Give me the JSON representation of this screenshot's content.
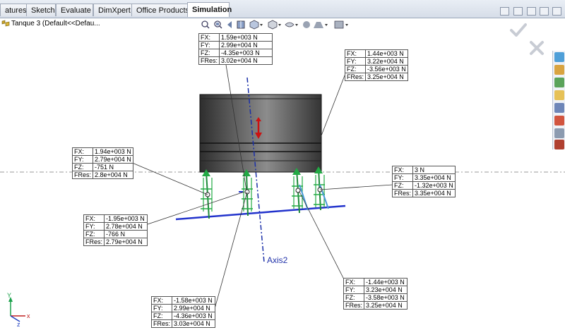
{
  "tabs": [
    {
      "label": "atures"
    },
    {
      "label": "Sketch"
    },
    {
      "label": "Evaluate"
    },
    {
      "label": "DimXpert"
    },
    {
      "label": "Office Products"
    },
    {
      "label": "Simulation",
      "active": true
    }
  ],
  "tree": {
    "label": "Tanque 3  (Default<<Defau..."
  },
  "axis_label": "Axis2",
  "triad": {
    "y": "Y",
    "x": "x",
    "z": "z"
  },
  "force_labels": [
    {
      "rows": [
        {
          "k": "FX:",
          "v": "1.59e+003 N"
        },
        {
          "k": "FY:",
          "v": "2.99e+004 N"
        },
        {
          "k": "FZ:",
          "v": "-4.35e+003 N"
        },
        {
          "k": "FRes:",
          "v": "3.02e+004 N"
        }
      ]
    },
    {
      "rows": [
        {
          "k": "FX:",
          "v": "1.44e+003 N"
        },
        {
          "k": "FY:",
          "v": "3.22e+004 N"
        },
        {
          "k": "FZ:",
          "v": "-3.56e+003 N"
        },
        {
          "k": "FRes:",
          "v": "3.25e+004 N"
        }
      ]
    },
    {
      "rows": [
        {
          "k": "FX:",
          "v": "1.94e+003 N"
        },
        {
          "k": "FY:",
          "v": "2.79e+004 N"
        },
        {
          "k": "FZ:",
          "v": "-751 N"
        },
        {
          "k": "FRes:",
          "v": "2.8e+004 N"
        }
      ]
    },
    {
      "rows": [
        {
          "k": "FX:",
          "v": "3 N"
        },
        {
          "k": "FY:",
          "v": "3.35e+004 N"
        },
        {
          "k": "FZ:",
          "v": "-1.32e+003 N"
        },
        {
          "k": "FRes:",
          "v": "3.35e+004 N"
        }
      ]
    },
    {
      "rows": [
        {
          "k": "FX:",
          "v": "-1.95e+003 N"
        },
        {
          "k": "FY:",
          "v": "2.78e+004 N"
        },
        {
          "k": "FZ:",
          "v": "-766 N"
        },
        {
          "k": "FRes:",
          "v": "2.79e+004 N"
        }
      ]
    },
    {
      "rows": [
        {
          "k": "FX:",
          "v": "-1.44e+003 N"
        },
        {
          "k": "FY:",
          "v": "3.23e+004 N"
        },
        {
          "k": "FZ:",
          "v": "-3.58e+003 N"
        },
        {
          "k": "FRes:",
          "v": "3.25e+004 N"
        }
      ]
    },
    {
      "rows": [
        {
          "k": "FX:",
          "v": "-1.58e+003 N"
        },
        {
          "k": "FY:",
          "v": "2.99e+004 N"
        },
        {
          "k": "FZ:",
          "v": "-4.36e+003 N"
        },
        {
          "k": "FRes:",
          "v": "3.03e+004 N"
        }
      ]
    }
  ],
  "icons": {
    "confirm": "check-icon",
    "cancel": "close-icon",
    "heads_up": [
      "zoom-to-fit-icon",
      "zoom-area-icon",
      "previous-view-icon",
      "section-view-icon",
      "view-orientation-icon",
      "display-style-icon",
      "hide-show-icon",
      "edit-appearance-icon",
      "apply-scene-icon",
      "view-settings-icon"
    ]
  },
  "colors": {
    "arrow_green": "#22aa44",
    "beam_blue": "#2233cc",
    "axis_blue": "#1a2fa8",
    "cylinder_dark": "#4a4a4a",
    "force_red": "#cc1111"
  }
}
